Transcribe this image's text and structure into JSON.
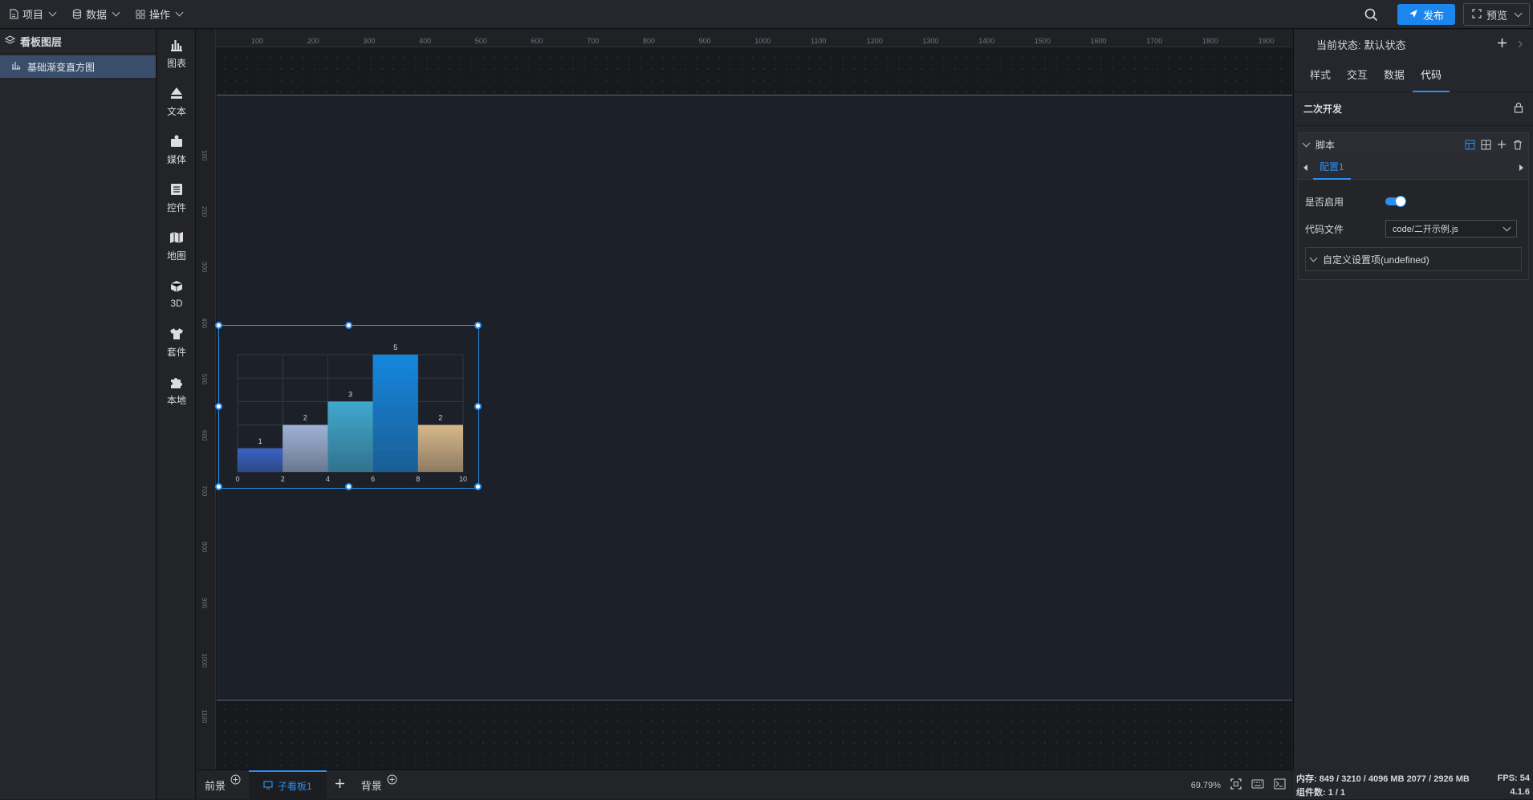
{
  "menus": [
    {
      "label": "项目",
      "icon": "file-icon"
    },
    {
      "label": "数据",
      "icon": "database-icon"
    },
    {
      "label": "操作",
      "icon": "grid-icon"
    }
  ],
  "top_right": {
    "publish": "发布",
    "preview": "预览"
  },
  "layers": {
    "title": "看板图层",
    "items": [
      "基础渐变直方图"
    ]
  },
  "tools": [
    "图表",
    "文本",
    "媒体",
    "控件",
    "地图",
    "3D",
    "套件",
    "本地"
  ],
  "ruler_top": [
    "100",
    "200",
    "300",
    "400",
    "500",
    "600",
    "700",
    "800",
    "900",
    "1000",
    "1100",
    "1200",
    "1300",
    "1400",
    "1500",
    "1600",
    "1700",
    "1800",
    "1900"
  ],
  "ruler_left": [
    "100",
    "200",
    "300",
    "400",
    "500",
    "600",
    "700",
    "800",
    "900",
    "1000",
    "1100"
  ],
  "chart_data": {
    "type": "bar",
    "x_ticks": [
      "0",
      "2",
      "4",
      "6",
      "8",
      "10"
    ],
    "categories": [
      "0-2",
      "2-4",
      "4-6",
      "6-8",
      "8-10"
    ],
    "values": [
      1,
      2,
      3,
      5,
      2
    ],
    "ylim": [
      0,
      5
    ],
    "grid": true,
    "colors": [
      "#3a63c7",
      "#9fb2d6",
      "#40a9cf",
      "#1687dd",
      "#d8b88a"
    ]
  },
  "bottom_tabs": {
    "foreground": "前景",
    "sub_board": "子看板1",
    "background": "背景"
  },
  "bottom_status": {
    "zoom": "69.79%"
  },
  "panel": {
    "state_label": "当前状态:",
    "state_value": "默认状态",
    "tabs": [
      "样式",
      "交互",
      "数据",
      "代码"
    ],
    "active_tab": "代码",
    "dev_title": "二次开发",
    "script_title": "脚本",
    "config_tab": "配置1",
    "enable_label": "是否启用",
    "code_file_label": "代码文件",
    "code_file_value": "code/二开示例.js",
    "custom_settings": "自定义设置项(undefined)"
  },
  "status": {
    "memory": "内存: 849 / 3210 / 4096 MB  2077 / 2926 MB",
    "fps": "FPS: 54",
    "components": "组件数: 1 / 1",
    "version": "4.1.6"
  }
}
